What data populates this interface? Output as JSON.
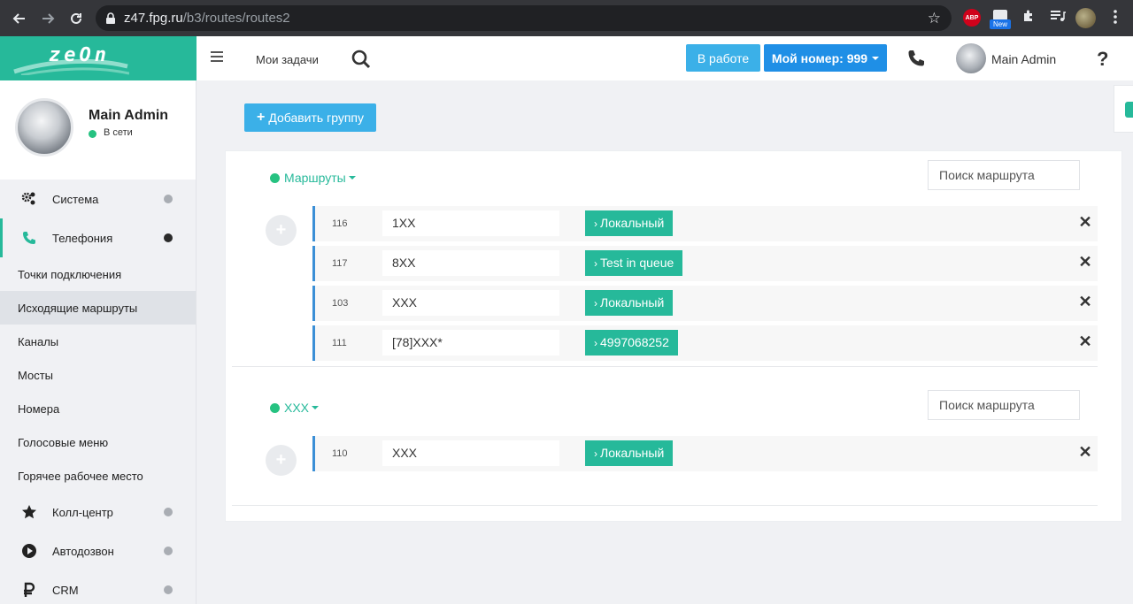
{
  "browser": {
    "url_host": "z47.fpg.ru",
    "url_path": "/b3/routes/routes2",
    "ext_abp": "ABP",
    "ext_new": "New"
  },
  "header": {
    "logo": "zeOn",
    "tasks_label": "Мои задачи",
    "status_label": "В работе",
    "number_label": "Мой номер: 999",
    "user_name": "Main Admin",
    "help": "?"
  },
  "sidebar": {
    "profile_name": "Main Admin",
    "profile_status": "В сети",
    "items": [
      {
        "label": "Система",
        "icon": "gears-icon"
      },
      {
        "label": "Телефония",
        "icon": "phone-icon"
      }
    ],
    "sub_items": [
      "Точки подключения",
      "Исходящие маршруты",
      "Каналы",
      "Мосты",
      "Номера",
      "Голосовые меню",
      "Горячее рабочее место"
    ],
    "items_after": [
      {
        "label": "Колл-центр",
        "icon": "star-icon"
      },
      {
        "label": "Автодозвон",
        "icon": "play-icon"
      },
      {
        "label": "CRM",
        "icon": "ruble-icon"
      }
    ]
  },
  "main": {
    "add_group_label": "Добавить группу",
    "search_placeholder": "Поиск маршрута",
    "groups": [
      {
        "name": "Маршруты",
        "routes": [
          {
            "id": "116",
            "pattern": "1XX",
            "dest": "Локальный"
          },
          {
            "id": "117",
            "pattern": "8XX",
            "dest": "Test in queue"
          },
          {
            "id": "103",
            "pattern": "XXX",
            "dest": "Локальный"
          },
          {
            "id": "111",
            "pattern": "[78]XXX*",
            "dest": "4997068252"
          }
        ]
      },
      {
        "name": "XXX",
        "routes": [
          {
            "id": "110",
            "pattern": "XXX",
            "dest": "Локальный"
          }
        ]
      }
    ]
  }
}
